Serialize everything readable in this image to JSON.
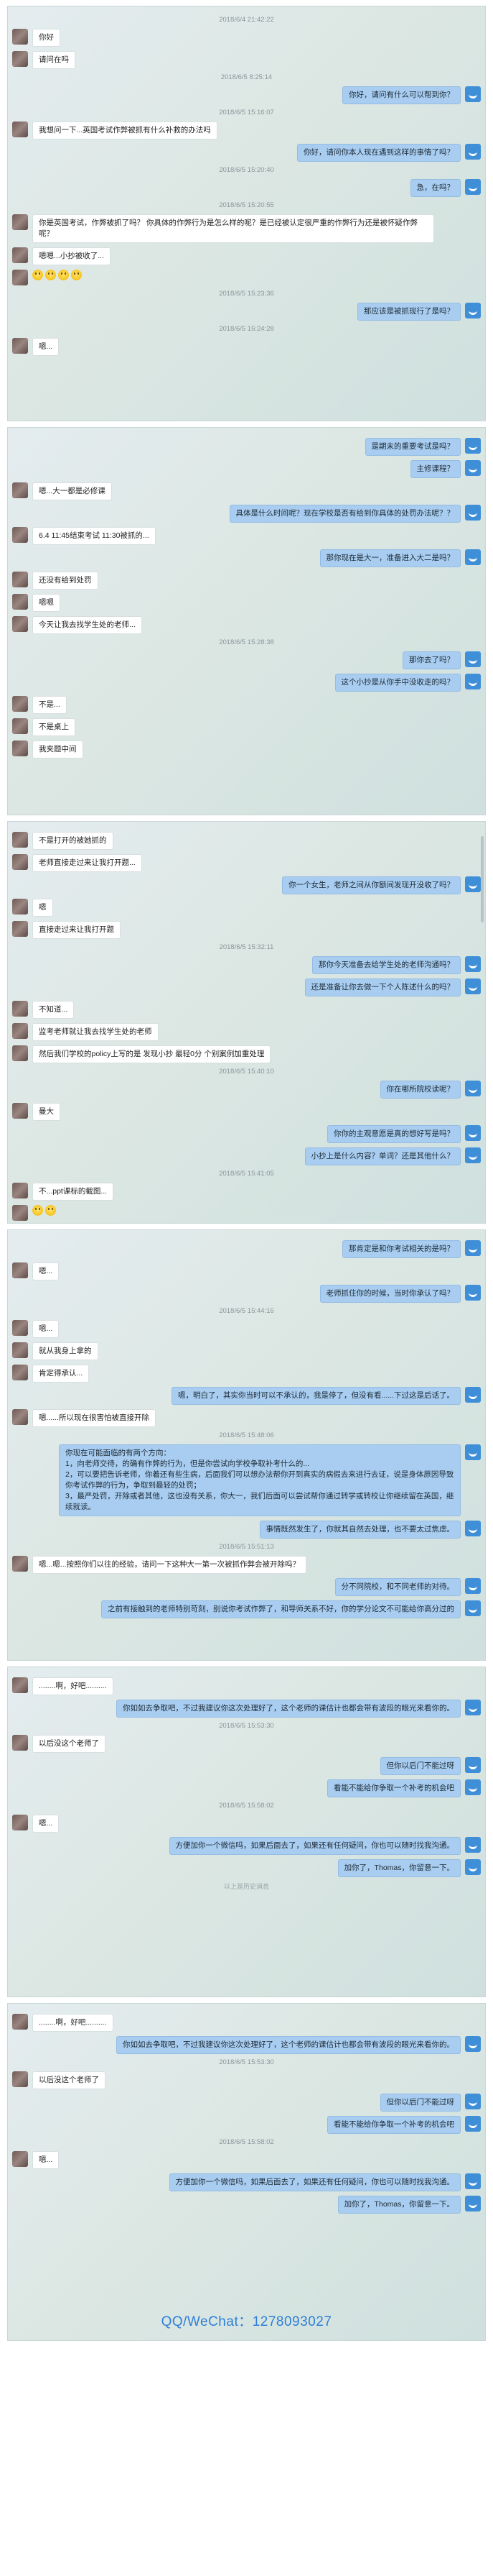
{
  "panels": [
    {
      "items": [
        {
          "t": "ts",
          "text": "2018/6/4 21:42:22"
        },
        {
          "t": "msg",
          "side": "left",
          "text": "你好"
        },
        {
          "t": "msg",
          "side": "left",
          "text": "请问在吗"
        },
        {
          "t": "ts",
          "text": "2018/6/5 8:25:14"
        },
        {
          "t": "msg",
          "side": "right",
          "text": "你好，请问有什么可以帮到你？"
        },
        {
          "t": "ts",
          "text": "2018/6/5 15:16:07"
        },
        {
          "t": "msg",
          "side": "left",
          "text": "我想问一下...英国考试作弊被抓有什么补救的办法吗"
        },
        {
          "t": "msg",
          "side": "right",
          "text": "你好，请问你本人现在遇到这样的事情了吗？"
        },
        {
          "t": "ts",
          "text": "2018/6/5 15:20:40"
        },
        {
          "t": "msg",
          "side": "right",
          "text": "急，在吗？"
        },
        {
          "t": "ts",
          "text": "2018/6/5 15:20:55"
        },
        {
          "t": "msg",
          "side": "left",
          "text": "你是英国考试，作弊被抓了吗？ 你具体的作弊行为是怎么样的呢？是已经被认定很严重的作弊行为还是被怀疑作弊呢？"
        },
        {
          "t": "msg",
          "side": "left",
          "text": "嗯嗯...小抄被收了..."
        },
        {
          "t": "emoji",
          "side": "left",
          "count": 4
        },
        {
          "t": "ts",
          "text": "2018/6/5 15:23:36"
        },
        {
          "t": "msg",
          "side": "right",
          "text": "那应该是被抓现行了是吗？"
        },
        {
          "t": "ts",
          "text": "2018/6/5 15:24:28"
        },
        {
          "t": "msg",
          "side": "left",
          "text": "嗯..."
        }
      ]
    },
    {
      "items": [
        {
          "t": "msg",
          "side": "right",
          "text": "是期末的重要考试是吗？"
        },
        {
          "t": "msg",
          "side": "right",
          "text": "主修课程？"
        },
        {
          "t": "msg",
          "side": "left",
          "text": "嗯...大一都是必修课"
        },
        {
          "t": "msg",
          "side": "right",
          "text": "具体是什么时间呢？现在学校是否有给到你具体的处罚办法呢？？"
        },
        {
          "t": "msg",
          "side": "left",
          "text": "6.4 11:45结束考试 11:30被抓的..."
        },
        {
          "t": "msg",
          "side": "right",
          "text": "那你现在是大一，准备进入大二是吗？"
        },
        {
          "t": "msg",
          "side": "left",
          "text": "还没有给到处罚"
        },
        {
          "t": "msg",
          "side": "left",
          "text": "嗯嗯"
        },
        {
          "t": "msg",
          "side": "left",
          "text": "今天让我去找学生处的老师..."
        },
        {
          "t": "ts",
          "text": "2018/6/5 15:28:38"
        },
        {
          "t": "msg",
          "side": "right",
          "text": "那你去了吗？"
        },
        {
          "t": "msg",
          "side": "right",
          "text": "这个小抄是从你手中没收走的吗？"
        },
        {
          "t": "msg",
          "side": "left",
          "text": "不是..."
        },
        {
          "t": "msg",
          "side": "left",
          "text": "不是桌上"
        },
        {
          "t": "msg",
          "side": "left",
          "text": "我夹题中间"
        }
      ]
    },
    {
      "items": [
        {
          "t": "msg",
          "side": "left",
          "text": "不是打开的被她抓的"
        },
        {
          "t": "msg",
          "side": "left",
          "text": "老师直接走过来让我打开题..."
        },
        {
          "t": "msg",
          "side": "right",
          "text": "你一个女生，老师之间从你额间发现开没收了吗？"
        },
        {
          "t": "msg",
          "side": "left",
          "text": "嗯"
        },
        {
          "t": "msg",
          "side": "left",
          "text": "直接走过来让我打开题"
        },
        {
          "t": "ts",
          "text": "2018/6/5 15:32:11"
        },
        {
          "t": "msg",
          "side": "right",
          "text": "那你今天准备去给学生处的老师沟通吗？"
        },
        {
          "t": "msg",
          "side": "right",
          "text": "还是准备让你去做一下个人陈述什么的吗？"
        },
        {
          "t": "msg",
          "side": "left",
          "text": "不知道..."
        },
        {
          "t": "msg",
          "side": "left",
          "text": "监考老师就让我去找学生处的老师"
        },
        {
          "t": "msg",
          "side": "left",
          "text": "然后我们学校的policy上写的是 发现小抄 最轻0分 个别案例加重处理"
        },
        {
          "t": "ts",
          "text": "2018/6/5 15:40:10"
        },
        {
          "t": "msg",
          "side": "right",
          "text": "你在哪所院校读呢？"
        },
        {
          "t": "msg",
          "side": "left",
          "text": "曼大"
        },
        {
          "t": "msg",
          "side": "right",
          "text": "你你的主观意愿是真的想好写是吗？"
        },
        {
          "t": "msg",
          "side": "right",
          "text": "小抄上是什么内容？单词？还是其他什么？"
        },
        {
          "t": "ts",
          "text": "2018/6/5 15:41:05"
        },
        {
          "t": "msg",
          "side": "left",
          "text": "不...ppt课标的截图..."
        },
        {
          "t": "emoji",
          "side": "left",
          "count": 2
        }
      ]
    },
    {
      "items": [
        {
          "t": "msg",
          "side": "right",
          "text": "那肯定是和你考试相关的是吗？"
        },
        {
          "t": "msg",
          "side": "left",
          "text": "嗯..."
        },
        {
          "t": "msg",
          "side": "right",
          "text": "老师抓住你的时候，当时你承认了吗？"
        },
        {
          "t": "ts",
          "text": "2018/6/5 15:44:16"
        },
        {
          "t": "msg",
          "side": "left",
          "text": "嗯..."
        },
        {
          "t": "msg",
          "side": "left",
          "text": "就从我身上拿的"
        },
        {
          "t": "msg",
          "side": "left",
          "text": "肯定得承认..."
        },
        {
          "t": "msg",
          "side": "right",
          "text": "嗯，明白了，其实你当时可以不承认的，我是停了，但没有看......下过这是后话了。"
        },
        {
          "t": "msg",
          "side": "left",
          "text": "嗯......所以现在很害怕被直接开除"
        },
        {
          "t": "ts",
          "text": "2018/6/5 15:48:06"
        },
        {
          "t": "msg",
          "side": "right",
          "text": "你现在可能面临的有两个方向：\n1，向老师交待，的确有作弊的行为，但是你尝试向学校争取补考什么的...\n2，可以要把告诉老师，你着还有些生病，后面我们可以想办法帮你开到真实的病假去来进行去证，说是身体原因导致你考试作弊的行为，争取到最轻的处罚；\n3，最严处罚，开除或者其他，这也没有关系，你大一，我们后面可以尝试帮你通过转学或转校让你继续留在英国，继续就读。"
        },
        {
          "t": "msg",
          "side": "right",
          "text": "事情既然发生了，你就其自然去处理，也不要太过焦虑。"
        },
        {
          "t": "ts",
          "text": "2018/6/5 15:51:13"
        },
        {
          "t": "msg",
          "side": "left",
          "text": "嗯...嗯...按照你们以往的经验，请问一下这种大一第一次被抓作弊会被开除吗？"
        },
        {
          "t": "msg",
          "side": "right",
          "text": "分不同院校，和不同老师的对待。"
        },
        {
          "t": "msg",
          "side": "right",
          "text": "之前有接触到的老师特别苛刻，别说你考试作弊了，和导师关系不好，你的学分论文不可能给你高分过的"
        }
      ]
    },
    {
      "items": [
        {
          "t": "msg",
          "side": "left",
          "text": "........啊，好吧.........."
        },
        {
          "t": "msg",
          "side": "right",
          "text": "你如如去争取吧，不过我建议你这次处理好了，这个老师的课估计也都会带有波段的眼光来看你的。"
        },
        {
          "t": "ts",
          "text": "2018/6/5 15:53:30"
        },
        {
          "t": "msg",
          "side": "left",
          "text": "以后没这个老师了"
        },
        {
          "t": "msg",
          "side": "right",
          "text": "但你以后门不能过呀"
        },
        {
          "t": "msg",
          "side": "right",
          "text": "看能不能给你争取一个补考的机会吧"
        },
        {
          "t": "ts",
          "text": "2018/6/5 15:58:02"
        },
        {
          "t": "msg",
          "side": "left",
          "text": "嗯..."
        },
        {
          "t": "msg",
          "side": "right",
          "text": "方便加你一个微信吗，如果后面去了，如果还有任何疑问，你也可以随时找我沟通。"
        },
        {
          "t": "msg",
          "side": "right",
          "text": "加你了，Thomas，你留意一下。"
        }
      ],
      "footer": "以上是历史消息"
    },
    {
      "items": [
        {
          "t": "msg",
          "side": "left",
          "text": "........啊，好吧.........."
        },
        {
          "t": "msg",
          "side": "right",
          "text": "你如如去争取吧，不过我建议你这次处理好了，这个老师的课估计也都会带有波段的眼光来看你的。"
        },
        {
          "t": "ts",
          "text": "2018/6/5 15:53:30"
        },
        {
          "t": "msg",
          "side": "left",
          "text": "以后没这个老师了"
        },
        {
          "t": "msg",
          "side": "right",
          "text": "但你以后门不能过呀"
        },
        {
          "t": "msg",
          "side": "right",
          "text": "看能不能给你争取一个补考的机会吧"
        },
        {
          "t": "ts",
          "text": "2018/6/5 15:58:02"
        },
        {
          "t": "msg",
          "side": "left",
          "text": "嗯..."
        },
        {
          "t": "msg",
          "side": "right",
          "text": "方便加你一个微信吗，如果后面去了，如果还有任何疑问，你也可以随时找我沟通。"
        },
        {
          "t": "msg",
          "side": "right",
          "text": "加你了，Thomas，你留意一下。"
        }
      ],
      "watermark": "QQ/WeChat：1278093027"
    }
  ]
}
